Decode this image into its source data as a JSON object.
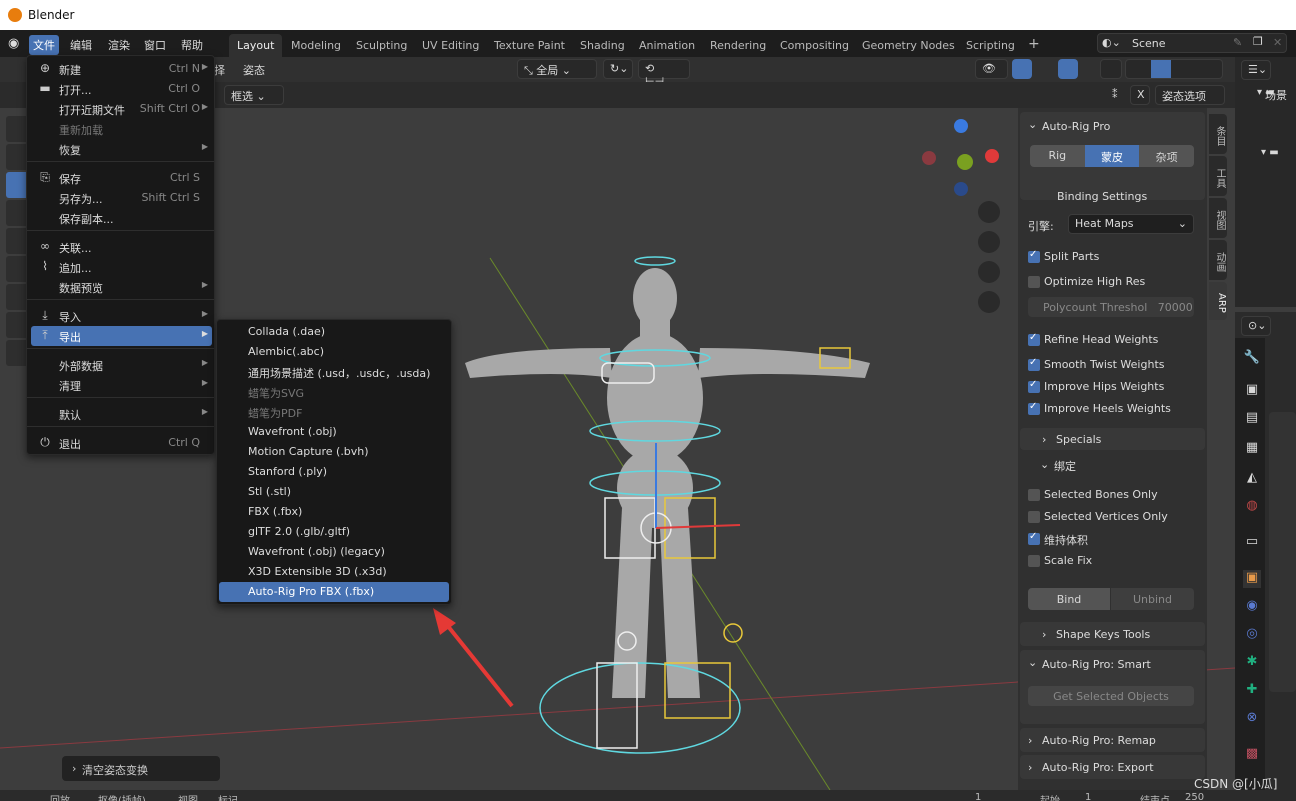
{
  "app": {
    "title": "Blender"
  },
  "menubar": {
    "items": [
      "文件",
      "编辑",
      "渲染",
      "窗口",
      "帮助"
    ],
    "active": "文件"
  },
  "workspaces": {
    "tabs": [
      "Layout",
      "Modeling",
      "Sculpting",
      "UV Editing",
      "Texture Paint",
      "Shading",
      "Animation",
      "Rendering",
      "Compositing",
      "Geometry Nodes",
      "Scripting"
    ],
    "active": "Layout",
    "add": "+"
  },
  "scene": {
    "label": "Scene"
  },
  "viewport_header": {
    "menus": [
      "择",
      "姿态"
    ],
    "orientation": "全局",
    "select_mode": "框选",
    "pose_options": "姿态选项",
    "x_label": "X"
  },
  "file_menu": {
    "items": [
      {
        "label": "新建",
        "shortcut": "Ctrl N",
        "submenu": true,
        "icon": "new-file-icon"
      },
      {
        "label": "打开...",
        "shortcut": "Ctrl O",
        "icon": "folder-icon"
      },
      {
        "label": "打开近期文件",
        "shortcut": "Shift Ctrl O",
        "submenu": true
      },
      {
        "label": "重新加载",
        "disabled": true
      },
      {
        "label": "恢复",
        "submenu": true
      },
      {
        "label": "保存",
        "shortcut": "Ctrl S",
        "icon": "save-icon"
      },
      {
        "label": "另存为...",
        "shortcut": "Shift Ctrl S"
      },
      {
        "label": "保存副本..."
      },
      {
        "label": "关联...",
        "icon": "link-icon"
      },
      {
        "label": "追加...",
        "icon": "paperclip-icon"
      },
      {
        "label": "数据预览",
        "submenu": true
      },
      {
        "label": "导入",
        "submenu": true,
        "icon": "import-icon"
      },
      {
        "label": "导出",
        "submenu": true,
        "icon": "export-icon",
        "highlighted": true
      },
      {
        "label": "外部数据",
        "submenu": true
      },
      {
        "label": "清理",
        "submenu": true
      },
      {
        "label": "默认",
        "submenu": true
      },
      {
        "label": "退出",
        "shortcut": "Ctrl Q",
        "icon": "power-icon"
      }
    ]
  },
  "export_menu": {
    "items": [
      {
        "label": "Collada (.dae)"
      },
      {
        "label": "Alembic(.abc)"
      },
      {
        "label": "通用场景描述 (.usd，.usdc，.usda)"
      },
      {
        "label": "蜡笔为SVG",
        "disabled": true
      },
      {
        "label": "蜡笔为PDF",
        "disabled": true
      },
      {
        "label": "Wavefront (.obj)"
      },
      {
        "label": "Motion Capture (.bvh)"
      },
      {
        "label": "Stanford (.ply)"
      },
      {
        "label": "Stl (.stl)"
      },
      {
        "label": "FBX (.fbx)"
      },
      {
        "label": "glTF 2.0 (.glb/.gltf)"
      },
      {
        "label": "Wavefront (.obj) (legacy)"
      },
      {
        "label": "X3D Extensible 3D (.x3d)"
      },
      {
        "label": "Auto-Rig Pro FBX (.fbx)",
        "highlighted": true
      }
    ]
  },
  "npanel": {
    "title": "Auto-Rig Pro",
    "tabs": [
      "Rig",
      "蒙皮",
      "杂项"
    ],
    "active_tab": "蒙皮",
    "binding_settings": "Binding Settings",
    "engine_label": "引擎:",
    "engine_value": "Heat Maps",
    "checks1": [
      {
        "label": "Split Parts",
        "checked": true
      },
      {
        "label": "Optimize High Res",
        "checked": false
      }
    ],
    "polycount_label": "Polycount Threshol",
    "polycount_value": "70000",
    "checks2": [
      {
        "label": "Refine Head Weights",
        "checked": true
      },
      {
        "label": "Smooth Twist Weights",
        "checked": true
      },
      {
        "label": "Improve Hips Weights",
        "checked": true
      },
      {
        "label": "Improve Heels Weights",
        "checked": true
      }
    ],
    "specials": "Specials",
    "bind_section": "绑定",
    "checks3": [
      {
        "label": "Selected Bones Only",
        "checked": false
      },
      {
        "label": "Selected Vertices Only",
        "checked": false
      },
      {
        "label": "维持体积",
        "checked": true
      },
      {
        "label": "Scale Fix",
        "checked": false
      }
    ],
    "bind": "Bind",
    "unbind": "Unbind",
    "shape_keys": "Shape Keys Tools",
    "smart": "Auto-Rig Pro: Smart",
    "get_selected": "Get Selected Objects",
    "remap": "Auto-Rig Pro: Remap",
    "export": "Auto-Rig Pro: Export"
  },
  "ntabs": [
    "条目",
    "工具",
    "视图",
    "动画",
    "ARP"
  ],
  "outliner": {
    "scene_label": "场景"
  },
  "toast": {
    "label": "清空姿态变换"
  },
  "timeline": {
    "playback": "回放",
    "keying": "抠像(插帧)",
    "view": "视图",
    "marker": "标记",
    "current_frame": "1",
    "start_label": "起始",
    "start": "1",
    "end_label": "结束点",
    "end": "250"
  },
  "watermark": "CSDN @[小瓜]",
  "colors": {
    "accent": "#4772b3",
    "rig_cyan": "#5fd8e0",
    "rig_yellow": "#e8c83a",
    "arrow_red": "#e53935"
  }
}
